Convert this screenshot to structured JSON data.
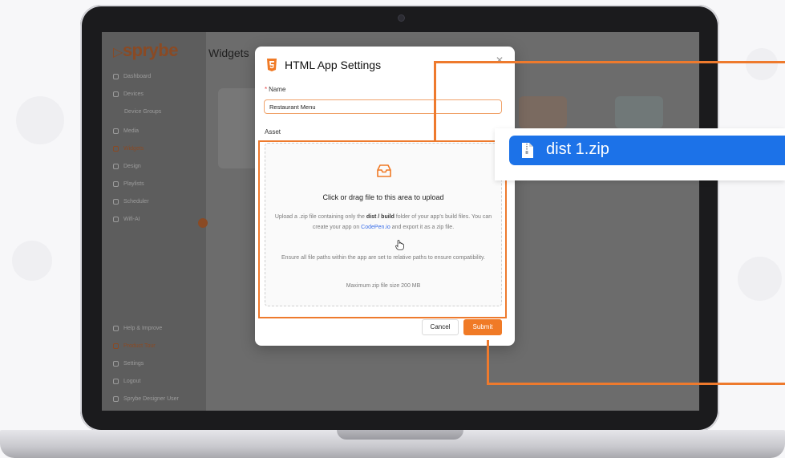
{
  "app": {
    "brand": "sprybe",
    "page_title": "Widgets",
    "sidebar": {
      "items": [
        {
          "label": "Dashboard",
          "icon": "dashboard-icon"
        },
        {
          "label": "Devices",
          "icon": "devices-icon"
        },
        {
          "label": "Device Groups",
          "icon": ""
        },
        {
          "label": "Media",
          "icon": "media-icon"
        },
        {
          "label": "Widgets",
          "icon": "widgets-icon",
          "active": true
        },
        {
          "label": "Design",
          "icon": "design-icon"
        },
        {
          "label": "Playlists",
          "icon": "playlists-icon"
        },
        {
          "label": "Scheduler",
          "icon": "scheduler-icon"
        },
        {
          "label": "Wifi-AI",
          "icon": "wifi-icon"
        }
      ],
      "bottom_items": [
        {
          "label": "Help & Improve",
          "icon": "help-icon"
        },
        {
          "label": "Product Tour",
          "icon": "tour-icon"
        },
        {
          "label": "Settings",
          "icon": "settings-icon"
        },
        {
          "label": "Logout",
          "icon": "logout-icon"
        },
        {
          "label": "Sprybe Designer User",
          "icon": "user-icon"
        }
      ]
    }
  },
  "modal": {
    "title": "HTML App Settings",
    "name_label": "Name",
    "name_value": "Restaurant Menu",
    "asset_label": "Asset",
    "upload": {
      "title": "Click or drag file to this area to upload",
      "text_before_build": "Upload a .zip file containing only the ",
      "dist_build": "dist / build",
      "text_after_build": " folder of your app's build files. You can create your app on ",
      "link": "CodePen.io",
      "text_after_link": " and export it as a zip file.",
      "relative_note": "Ensure all file paths within the app are set to relative paths to ensure compatibility.",
      "max_size": "Maximum zip file size 200 MB"
    },
    "cancel_label": "Cancel",
    "submit_label": "Submit"
  },
  "dragged_file": {
    "name": "dist 1.zip"
  },
  "colors": {
    "accent": "#f07a26",
    "callout": "#ee7a2d",
    "file_pill": "#1c72e8",
    "link": "#3a6ee8"
  }
}
